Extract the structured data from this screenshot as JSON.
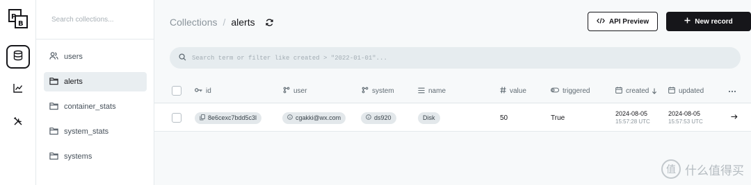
{
  "brand": {
    "logo_text": "PB"
  },
  "sidebar": {
    "search_placeholder": "Search collections...",
    "items": [
      {
        "label": "users",
        "icon": "users-icon",
        "active": false
      },
      {
        "label": "alerts",
        "icon": "folder-icon",
        "active": true
      },
      {
        "label": "container_stats",
        "icon": "folder-icon",
        "active": false
      },
      {
        "label": "system_stats",
        "icon": "folder-icon",
        "active": false
      },
      {
        "label": "systems",
        "icon": "folder-icon",
        "active": false
      }
    ]
  },
  "header": {
    "breadcrumb_parent": "Collections",
    "breadcrumb_separator": "/",
    "breadcrumb_current": "alerts",
    "api_preview_label": "API Preview",
    "new_record_label": "New record"
  },
  "filter": {
    "placeholder": "Search term or filter like created > \"2022-01-01\"..."
  },
  "table": {
    "columns": [
      {
        "label": "id",
        "icon": "key-icon"
      },
      {
        "label": "user",
        "icon": "relation-icon"
      },
      {
        "label": "system",
        "icon": "relation-icon"
      },
      {
        "label": "name",
        "icon": "list-icon"
      },
      {
        "label": "value",
        "icon": "hash-icon"
      },
      {
        "label": "triggered",
        "icon": "toggle-icon"
      },
      {
        "label": "created",
        "icon": "calendar-icon",
        "sort": "desc"
      },
      {
        "label": "updated",
        "icon": "calendar-icon"
      }
    ],
    "rows": [
      {
        "id": "8e6cexc7bdd5c3l",
        "user": "cgakki@wx.com",
        "system": "ds920",
        "name": "Disk",
        "value": "50",
        "triggered": "True",
        "created_date": "2024-08-05",
        "created_time": "15:57:28 UTC",
        "updated_date": "2024-08-05",
        "updated_time": "15:57:53 UTC"
      }
    ]
  },
  "watermark": {
    "badge": "值",
    "text": "什么值得买"
  },
  "colors": {
    "accent_dark": "#16161a",
    "active_bg": "#e9eef1",
    "pill_bg": "#e3e8eb",
    "main_bg": "#f7f9fa"
  }
}
